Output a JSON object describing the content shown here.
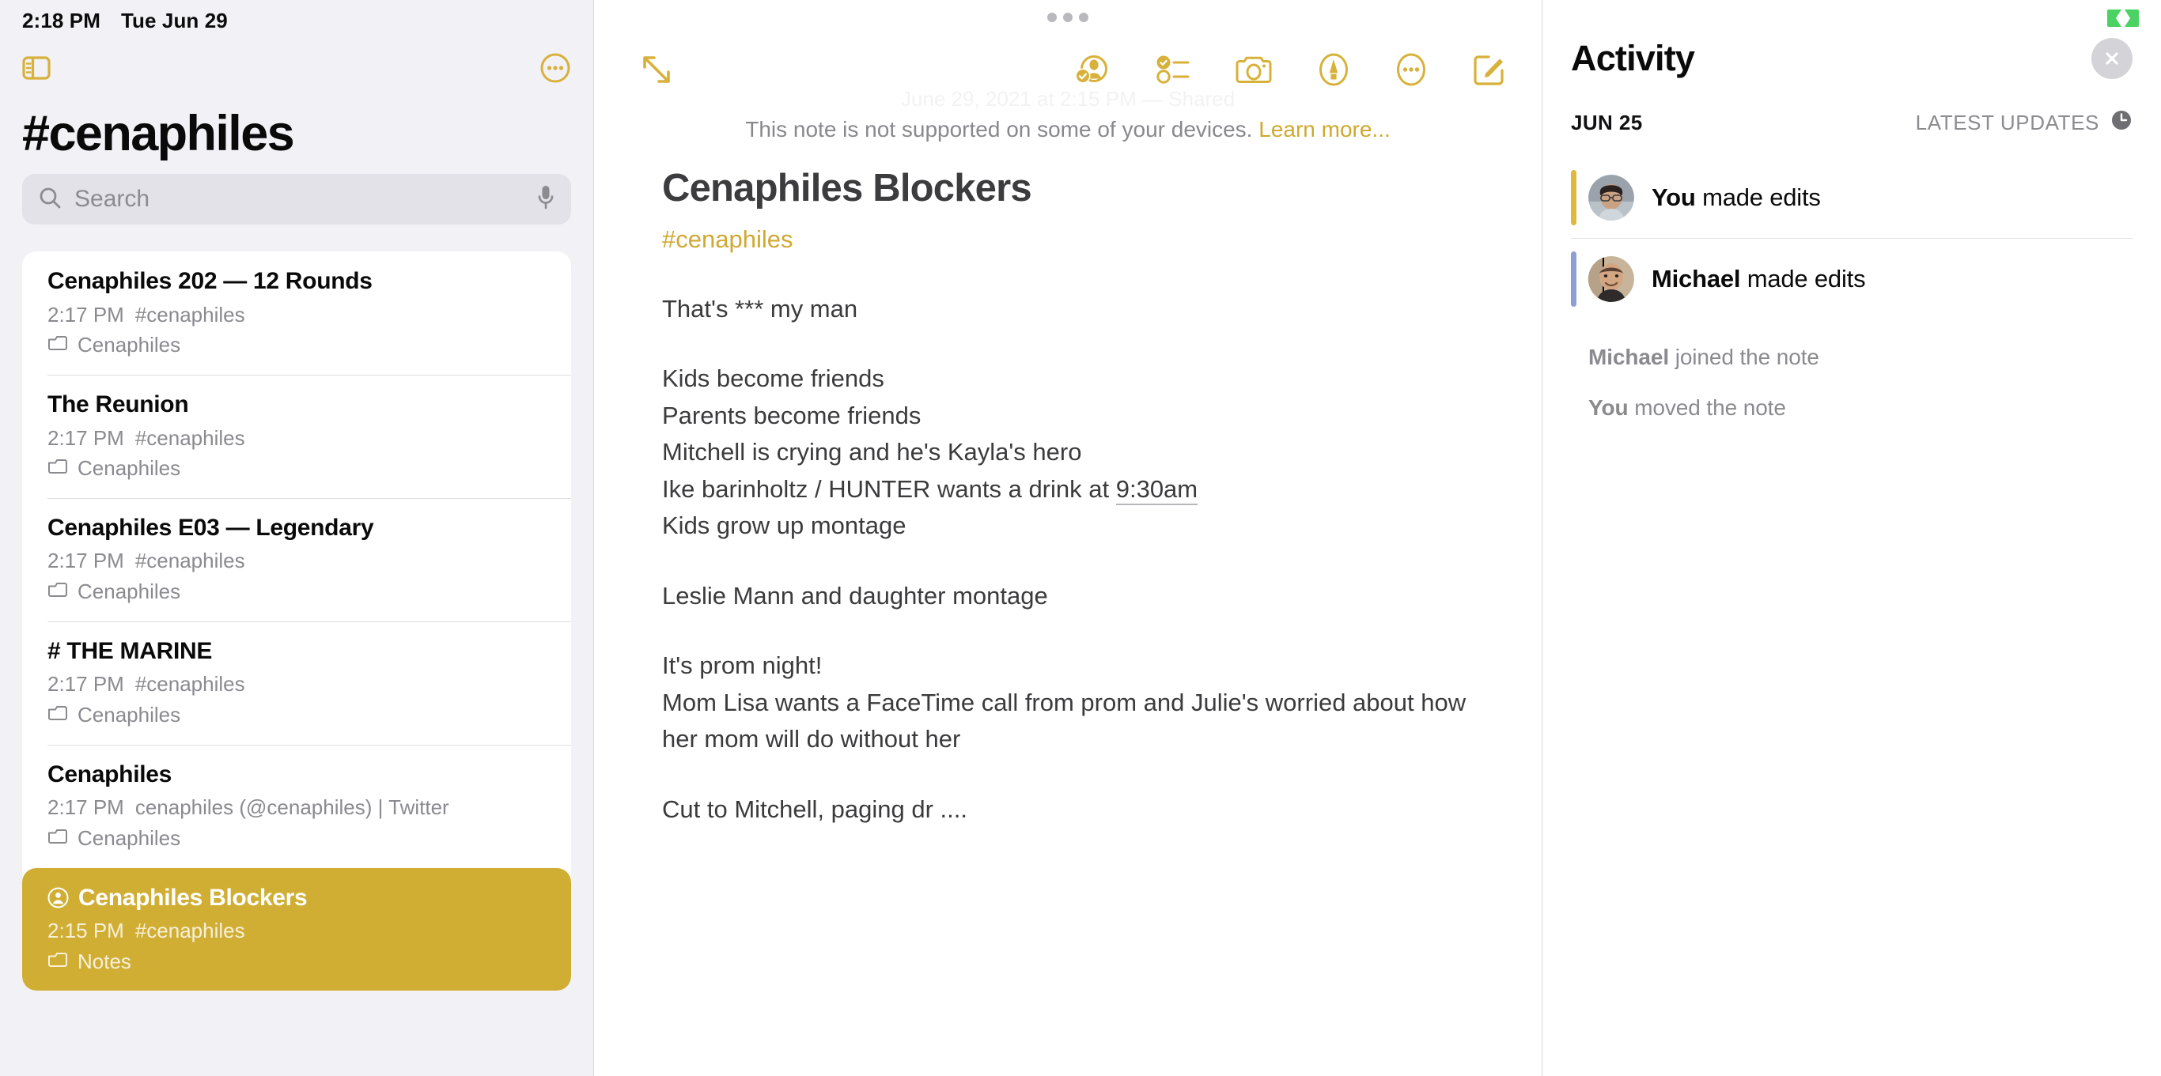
{
  "status_bar": {
    "time": "2:18 PM",
    "date": "Tue Jun 29"
  },
  "sidebar": {
    "sidebar_toggle_icon": "sidebar-toggle-icon",
    "more_icon": "more-circle-icon",
    "title": "#cenaphiles",
    "search": {
      "placeholder": "Search",
      "value": "",
      "search_icon": "search-icon",
      "mic_icon": "microphone-icon"
    },
    "notes": [
      {
        "title": "Cenaphiles 202 — 12 Rounds",
        "time": "2:17 PM",
        "subtitle": "#cenaphiles",
        "folder": "Cenaphiles",
        "selected": false,
        "shared": false
      },
      {
        "title": "The Reunion",
        "time": "2:17 PM",
        "subtitle": "#cenaphiles",
        "folder": "Cenaphiles",
        "selected": false,
        "shared": false
      },
      {
        "title": "Cenaphiles E03 — Legendary",
        "time": "2:17 PM",
        "subtitle": "#cenaphiles",
        "folder": "Cenaphiles",
        "selected": false,
        "shared": false
      },
      {
        "title": "# THE MARINE",
        "time": "2:17 PM",
        "subtitle": "#cenaphiles",
        "folder": "Cenaphiles",
        "selected": false,
        "shared": false
      },
      {
        "title": "Cenaphiles",
        "time": "2:17 PM",
        "subtitle": "cenaphiles (@cenaphiles) | Twitter",
        "folder": "Cenaphiles",
        "selected": false,
        "shared": false
      },
      {
        "title": "Cenaphiles Blockers",
        "time": "2:15 PM",
        "subtitle": "#cenaphiles",
        "folder": "Notes",
        "selected": true,
        "shared": true
      }
    ]
  },
  "note": {
    "grabber": "window-grabber-handle",
    "expand_icon": "expand-diagonal-icon",
    "toolbar_icons": [
      {
        "name": "share-participants-icon"
      },
      {
        "name": "checklist-icon"
      },
      {
        "name": "camera-icon"
      },
      {
        "name": "markup-pen-icon"
      },
      {
        "name": "more-circle-icon"
      },
      {
        "name": "compose-icon"
      }
    ],
    "date_ghost": "June 29, 2021 at 2:15 PM — Shared",
    "banner": {
      "text": "This note is not supported on some of your devices.",
      "link": "Learn more..."
    },
    "heading": "Cenaphiles Blockers",
    "tag": "#cenaphiles",
    "body": {
      "p1": "That's *** my man",
      "p2_line1": "Kids become friends",
      "p2_line2": "Parents become friends",
      "p2_line3": "Mitchell is crying and he's Kayla's hero",
      "p2_line4_pre": "Ike barinholtz / HUNTER wants a drink at ",
      "p2_line4_link": "9:30am",
      "p2_line5": "Kids grow up montage",
      "p3": "Leslie Mann and daughter montage",
      "p4_line1": "It's prom night!",
      "p4_line2": "Mom Lisa wants a FaceTime call from prom and Julie's worried about how her mom will do without her",
      "p5": "Cut to Mitchell, paging dr ...."
    }
  },
  "activity": {
    "recording_indicator": "screen-recording-indicator",
    "title": "Activity",
    "close_icon": "close-icon",
    "date_label": "JUN 25",
    "updates_label": "LATEST UPDATES",
    "clock_icon": "clock-icon",
    "entries": [
      {
        "actor": "You",
        "action": " made edits",
        "bar_color": "#dfb93c",
        "avatar": "avatar-you"
      },
      {
        "actor": "Michael",
        "action": " made edits",
        "bar_color": "#8e9fd4",
        "avatar": "avatar-michael"
      }
    ],
    "secondary": [
      {
        "actor": "Michael",
        "action": " joined the note"
      },
      {
        "actor": "You",
        "action": " moved the note"
      }
    ]
  },
  "colors": {
    "accent": "#d0a832",
    "selected_row": "#d0ae34",
    "sidebar_bg": "#f2f1f6",
    "recording_green": "#4cd263"
  }
}
